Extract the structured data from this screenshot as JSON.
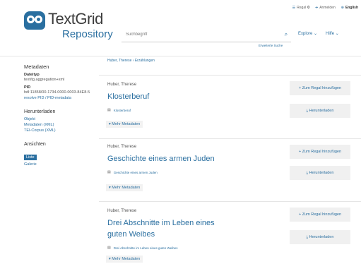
{
  "util": {
    "shelf": "Regal",
    "shelf_count": "0",
    "login": "Anmelden",
    "lang": "English"
  },
  "logo": {
    "brand": "TextGrid",
    "sub": "Repository"
  },
  "search": {
    "placeholder": "Suchbegriff",
    "advanced": "Erweiterte Suche"
  },
  "nav": {
    "explore": "Explore ⌄",
    "help": "Hilfe ⌄"
  },
  "sidebar": {
    "heading": "Metadaten",
    "type_label": "Dateityp",
    "type_value": "text/tg.aggregation+xml",
    "pid_label": "PID",
    "pid_value": "hdl:11858/00-1734-0000-0003-84E8-5",
    "pid_link": "resolve PID / PID-metadata",
    "download_heading": "Herunterladen",
    "download_links": [
      "Objekt",
      "Metadaten (XML)",
      "TEI-Corpus (XML)"
    ],
    "views_heading": "Ansichten",
    "views": [
      "Liste",
      "Galerie"
    ]
  },
  "breadcrumb": "Huber, Therese › Erzählungen",
  "results": [
    {
      "author": "Huber, Therese",
      "title": "Klosterberuf",
      "file": "Klosterberuf",
      "more": "▾ Mehr Metadaten",
      "add": "+ Zum Regal hinzufügen",
      "download": "⤓ Herunterladen"
    },
    {
      "author": "Huber, Therese",
      "title": "Geschichte eines armen Juden",
      "file": "Geschichte eines armen Juden",
      "more": "▾ Mehr Metadaten",
      "add": "+ Zum Regal hinzufügen",
      "download": "⤓ Herunterladen"
    },
    {
      "author": "Huber, Therese",
      "title": "Drei Abschnitte im Leben eines guten Weibes",
      "file": "Drei Abschnitte im Leben eines guten Weibes",
      "more": "▾ Mehr Metadaten",
      "add": "+ Zum Regal hinzufügen",
      "download": "⤓ Herunterladen"
    }
  ],
  "colors": {
    "accent": "#2a6fa0",
    "button_bg": "#f0f0f0"
  }
}
